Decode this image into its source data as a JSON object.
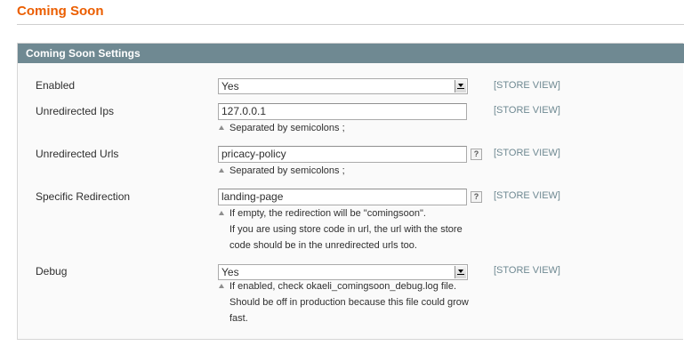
{
  "page": {
    "title": "Coming Soon"
  },
  "section": {
    "header": "Coming Soon Settings"
  },
  "fields": {
    "enabled": {
      "label": "Enabled",
      "value": "Yes",
      "scope": "[STORE VIEW]"
    },
    "unredirected_ips": {
      "label": "Unredirected Ips",
      "value": "127.0.0.1",
      "scope": "[STORE VIEW]",
      "note": "Separated by semicolons ;"
    },
    "unredirected_urls": {
      "label": "Unredirected Urls",
      "value": "pricacy-policy",
      "scope": "[STORE VIEW]",
      "help": "?",
      "note": "Separated by semicolons ;"
    },
    "specific_redirection": {
      "label": "Specific Redirection",
      "value": "landing-page",
      "scope": "[STORE VIEW]",
      "help": "?",
      "note_lines": [
        "If empty, the redirection will be \"comingsoon\".",
        "If you are using store code in url, the url with the store",
        "code should be in the unredirected urls too."
      ]
    },
    "debug": {
      "label": "Debug",
      "value": "Yes",
      "scope": "[STORE VIEW]",
      "note_lines": [
        "If enabled, check okaeli_comingsoon_debug.log file.",
        "Should be off in production because this file could grow",
        "fast."
      ]
    }
  },
  "icons": {
    "note_marker": "triangle-up-icon",
    "select_arrow": "chevron-down-icon",
    "help": "question-icon"
  },
  "colors": {
    "title": "#eb5e00",
    "header_bg": "#6f8992",
    "scope": "#6f8992"
  }
}
